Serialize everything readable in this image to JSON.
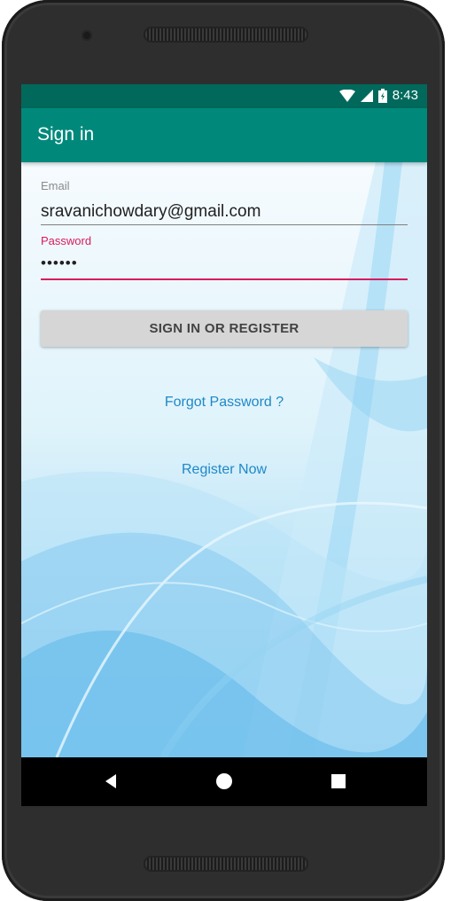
{
  "statusbar": {
    "time": "8:43",
    "icons": [
      "wifi-icon",
      "cell-signal-icon",
      "battery-charging-icon"
    ]
  },
  "appbar": {
    "title": "Sign in"
  },
  "form": {
    "email_label": "Email",
    "email_value": "sravanichowdary@gmail.com",
    "password_label": "Password",
    "password_value": "••••••",
    "submit_label": "SIGN IN OR REGISTER",
    "forgot_label": "Forgot Password ?",
    "register_label": "Register Now"
  },
  "navbar": {
    "icons": [
      "back-icon",
      "home-icon",
      "recents-icon"
    ]
  },
  "colors": {
    "status_bar": "#00695c",
    "app_bar": "#00897b",
    "accent_pink": "#d81b60",
    "link_blue": "#1e88c8",
    "button_gray": "#d6d6d6"
  }
}
